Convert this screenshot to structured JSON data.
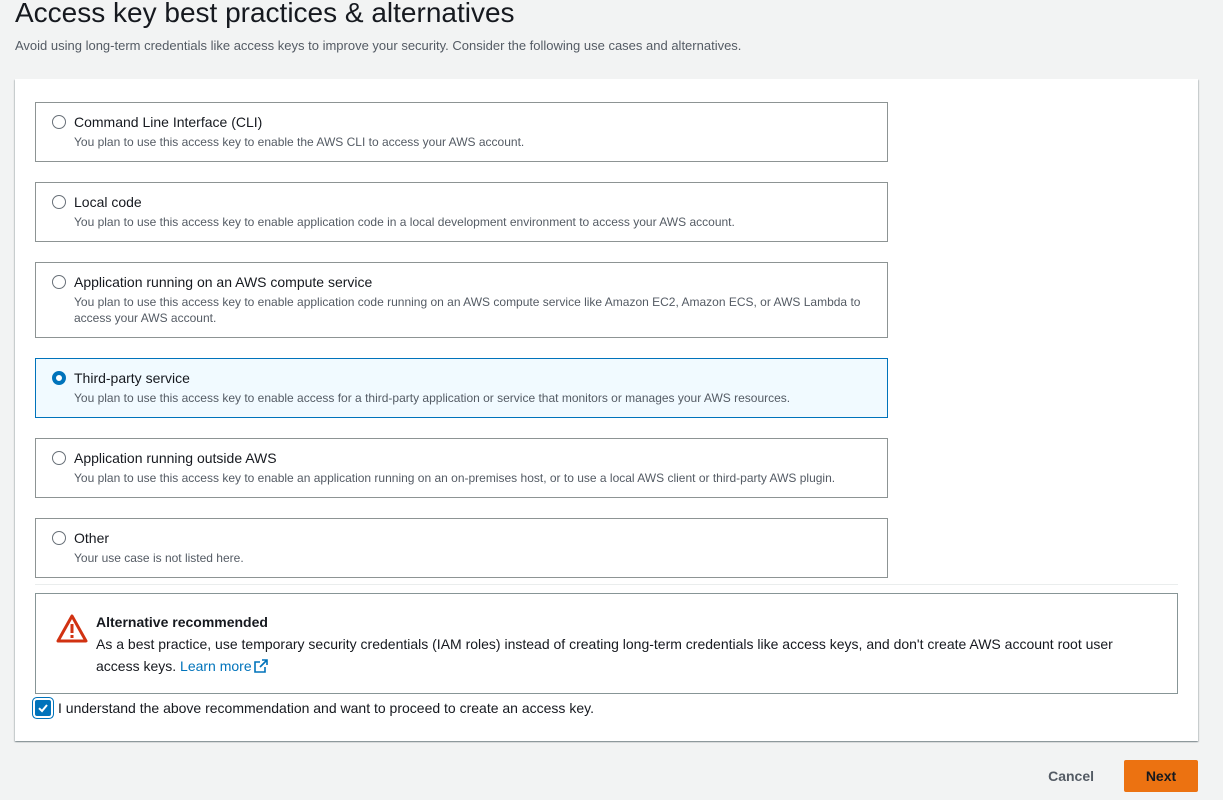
{
  "header": {
    "title": "Access key best practices & alternatives",
    "description": "Avoid using long-term credentials like access keys to improve your security. Consider the following use cases and alternatives."
  },
  "options": [
    {
      "label": "Command Line Interface (CLI)",
      "description": "You plan to use this access key to enable the AWS CLI to access your AWS account.",
      "selected": false
    },
    {
      "label": "Local code",
      "description": "You plan to use this access key to enable application code in a local development environment to access your AWS account.",
      "selected": false
    },
    {
      "label": "Application running on an AWS compute service",
      "description": "You plan to use this access key to enable application code running on an AWS compute service like Amazon EC2, Amazon ECS, or AWS Lambda to access your AWS account.",
      "selected": false
    },
    {
      "label": "Third-party service",
      "description": "You plan to use this access key to enable access for a third-party application or service that monitors or manages your AWS resources.",
      "selected": true
    },
    {
      "label": "Application running outside AWS",
      "description": "You plan to use this access key to enable an application running on an on-premises host, or to use a local AWS client or third-party AWS plugin.",
      "selected": false
    },
    {
      "label": "Other",
      "description": "Your use case is not listed here.",
      "selected": false
    }
  ],
  "alert": {
    "icon": "warning-icon",
    "title": "Alternative recommended",
    "text": "As a best practice, use temporary security credentials (IAM roles) instead of creating long-term credentials like access keys, and don't create AWS account root user access keys.",
    "link_label": "Learn more",
    "link_icon": "external-link-icon"
  },
  "acknowledgement": {
    "checked": true,
    "label": "I understand the above recommendation and want to proceed to create an access key."
  },
  "footer": {
    "cancel_label": "Cancel",
    "next_label": "Next"
  },
  "colors": {
    "accent": "#0073bb",
    "primary_button": "#ec7211",
    "warning": "#d13212"
  }
}
